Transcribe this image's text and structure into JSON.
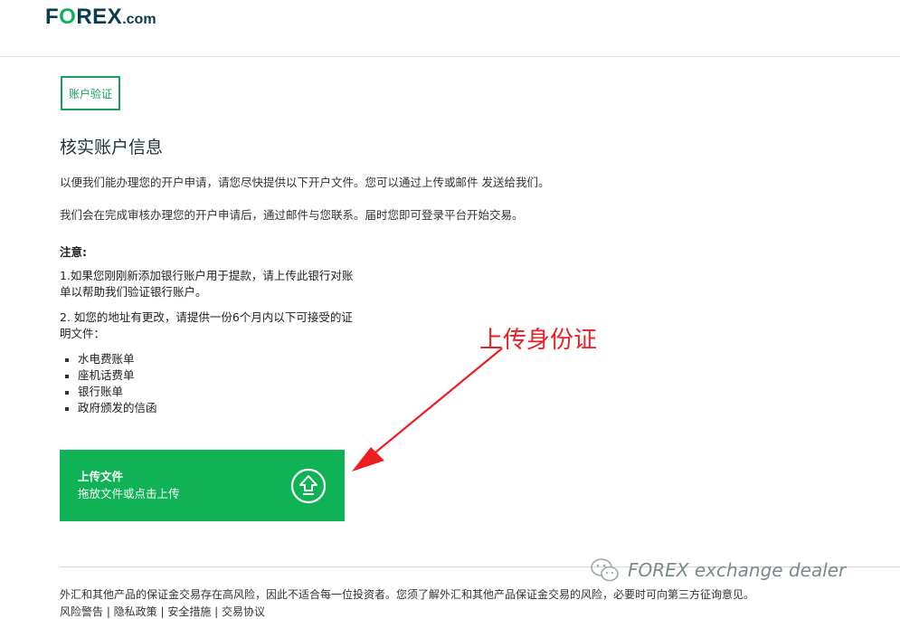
{
  "header": {
    "logo_part1": "F",
    "logo_o": "O",
    "logo_part2": "REX",
    "logo_com": ".com"
  },
  "tab": {
    "label": "账户验证"
  },
  "content": {
    "title": "核实账户信息",
    "paragraph1": "以便我们能办理您的开户申请，请您尽快提供以下开户文件。您可以通过上传或邮件 发送给我们。",
    "paragraph2": "我们会在完成审核办理您的开户申请后，通过邮件与您联系。届时您即可登录平台开始交易。",
    "note_label": "注意:",
    "note1": "1.如果您刚刚新添加银行账户用于提款，请上传此银行对账单以帮助我们验证银行账户。",
    "note2": "2. 如您的地址有更改，请提供一份6个月内以下可接受的证明文件：",
    "bullets": [
      "水电费账单",
      "座机话费单",
      "银行账单",
      "政府颁发的信函"
    ]
  },
  "upload": {
    "title": "上传文件",
    "subtitle": "拖放文件或点击上传",
    "icon": "upload-arrow-icon"
  },
  "annotation": {
    "text": "上传身份证"
  },
  "footer": {
    "risk": "外汇和其他产品的保证金交易存在高风险，因此不适合每一位投资者。您须了解外汇和其他产品保证金交易的风险，必要时可向第三方征询意见。",
    "line2": "风险警告 | 隐私政策 | 安全措施 | 交易协议"
  },
  "watermark": {
    "text": "FOREX exchange dealer"
  },
  "colors": {
    "brand_green": "#10b256",
    "brand_dark": "#0c3b4f",
    "annotation_red": "#ee1d24"
  }
}
